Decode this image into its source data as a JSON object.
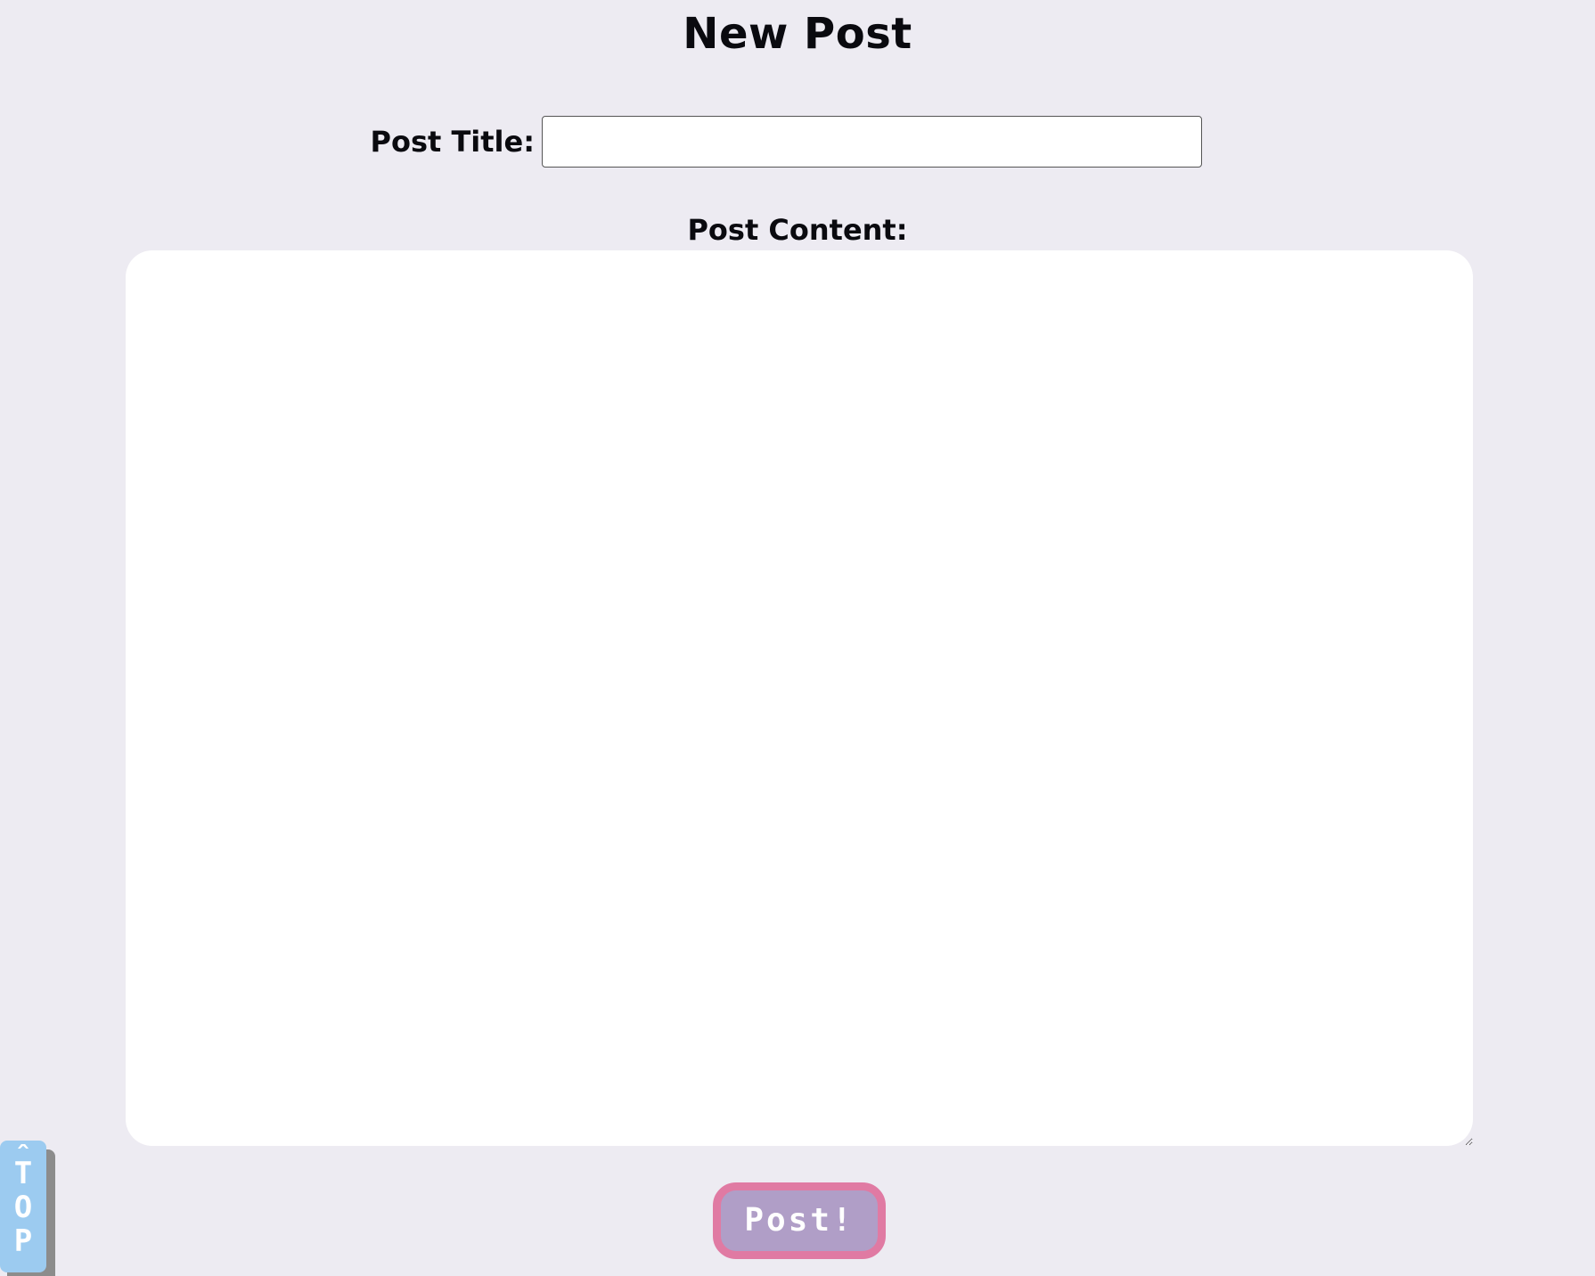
{
  "page": {
    "title": "New Post",
    "background_color": "#edebf2"
  },
  "form": {
    "title_label": "Post Title:",
    "title_value": "",
    "content_label": "Post Content:",
    "content_value": "",
    "submit_label": "Post!",
    "submit_colors": {
      "fill": "#b09ec7",
      "border": "#e07aa3"
    }
  },
  "scroll_top": {
    "arrow": "^",
    "label": "TOP",
    "color": "#9ccbf0",
    "icon": "caret-up-icon"
  }
}
